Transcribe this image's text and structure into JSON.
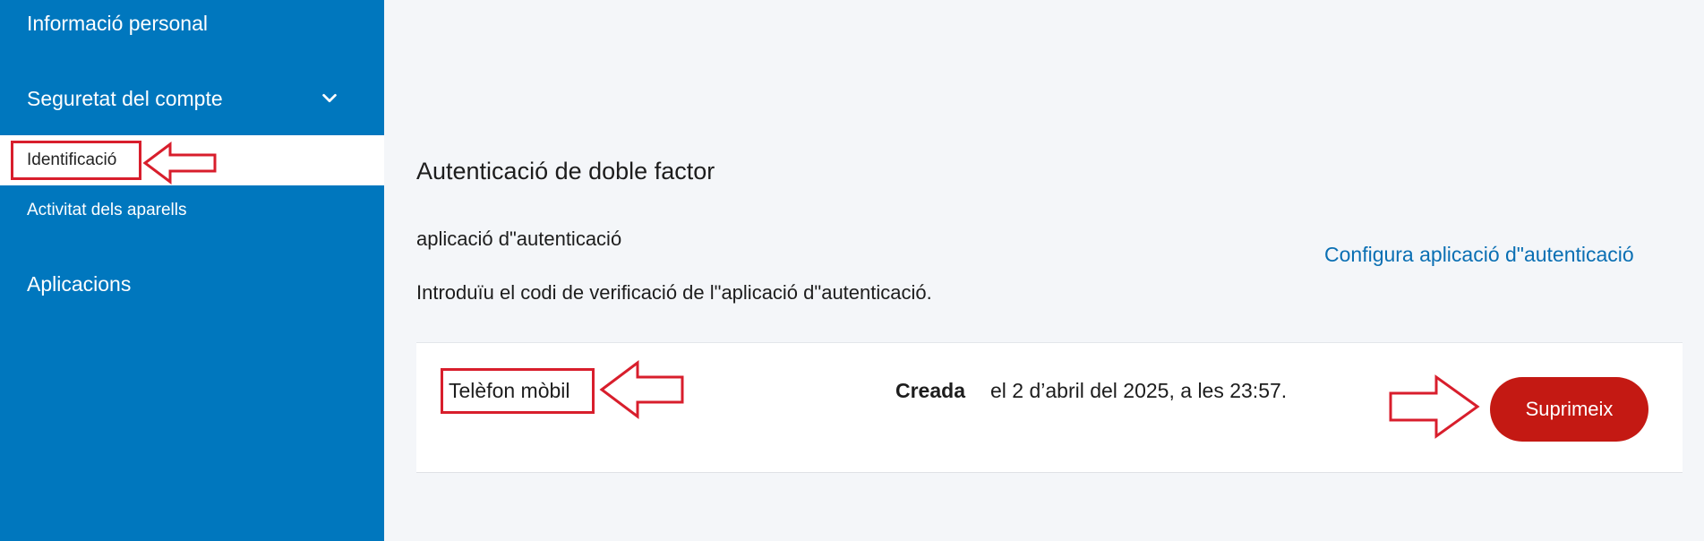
{
  "sidebar": {
    "items": [
      {
        "label": "Informació personal"
      },
      {
        "label": "Seguretat del compte"
      },
      {
        "label": "Identificació"
      },
      {
        "label": "Activitat dels aparells"
      },
      {
        "label": "Aplicacions"
      }
    ],
    "expanded_icon": "chevron-down-icon",
    "background": "#0077be"
  },
  "main": {
    "section_title": "Autenticació de doble factor",
    "method_name": "aplicació d\"autenticació",
    "config_link": "Configura aplicació d\"autenticació",
    "instructions": "Introduïu el codi de verificació de l\"aplicació d\"autenticació.",
    "device": {
      "name": "Telèfon mòbil",
      "created_label": "Creada",
      "created_value": "el 2 d’abril del 2025, a les 23:57.",
      "delete_label": "Suprimeix",
      "delete_color": "#c41913"
    }
  },
  "annotations": {
    "color": "#d81e2c",
    "arrow_icon": "red-outline-arrow-icon"
  }
}
